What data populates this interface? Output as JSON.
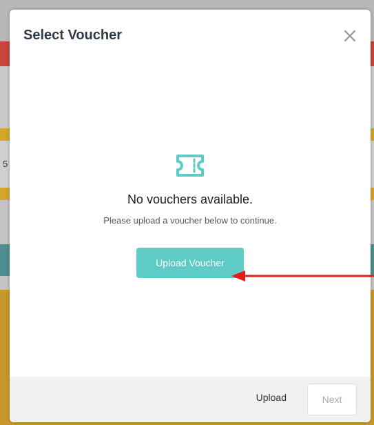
{
  "modal": {
    "title": "Select Voucher",
    "close_icon": "close-icon",
    "empty_state": {
      "icon": "ticket-icon",
      "title": "No vouchers available.",
      "subtitle": "Please upload a voucher below to continue.",
      "button_label": "Upload Voucher"
    },
    "footer": {
      "upload_label": "Upload",
      "next_label": "Next"
    }
  },
  "background": {
    "fragment_char": "5"
  },
  "colors": {
    "accent": "#5fcbc6",
    "title_text": "#2f3a47",
    "annotation_arrow": "#e41b1b",
    "disabled_text": "#a8acb2"
  }
}
